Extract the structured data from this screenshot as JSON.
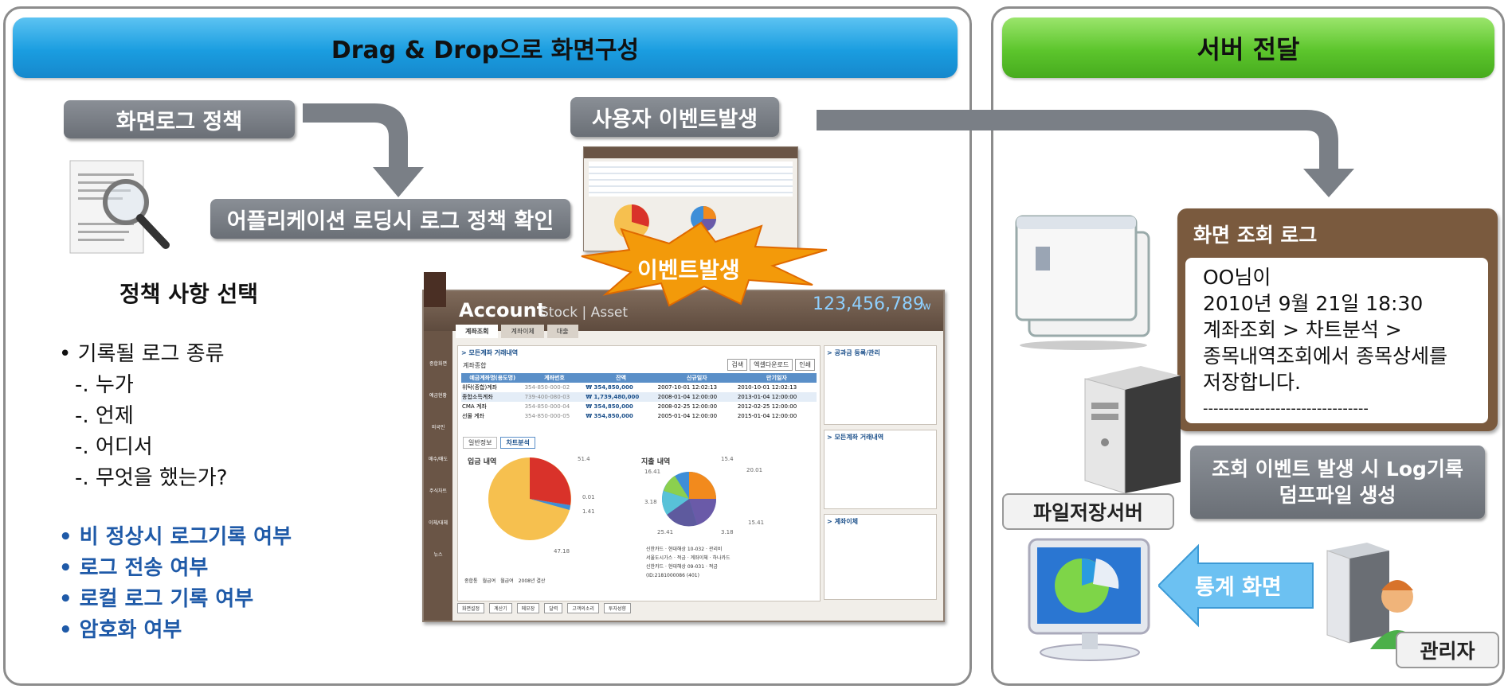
{
  "left_panel": {
    "banner": "Drag & Drop으로 화면구성",
    "policy_box": "화면로그 정책",
    "app_loading_box": "어플리케이션 로딩시 로그 정책 확인",
    "user_event_box": "사용자 이벤트발생",
    "policy_select_title": "정책 사항 선택",
    "bullets": [
      "• 기록될 로그 종류",
      "-. 누가",
      "-. 언제",
      "-. 어디서",
      "-. 무엇을 했는가?"
    ],
    "blue_bullets": [
      "• 비 정상시 로그기록 여부",
      "• 로그 전송 여부",
      "• 로컬 로그 기록 여부",
      "• 암호화 여부"
    ],
    "event_burst": "이벤트발생"
  },
  "account_screen": {
    "title": "Account",
    "subtitle": "Stock | Asset",
    "amount": "123,456,789",
    "amount_unit": "w",
    "tabs": [
      "계좌조회",
      "계좌이체",
      "대출"
    ],
    "section_title": "> 모든계좌 거래내역",
    "filter_label": "계좌종합",
    "buttons": [
      "검색",
      "엑셀다운로드",
      "인쇄"
    ],
    "table_headers": [
      "예금계좌명(용도명)",
      "계좌번호",
      "잔액",
      "신규일자",
      "만기일자"
    ],
    "table_rows": [
      [
        "위탁(종합)계좌",
        "354-850-000-02",
        "₩ 354,850,000",
        "2007-10-01 12:02:13",
        "2010-10-01 12:02:13"
      ],
      [
        "종합소득계좌",
        "739-400-080-03",
        "₩ 1,739,480,000",
        "2008-01-04 12:00:00",
        "2013-01-04 12:00:00"
      ],
      [
        "CMA 계좌",
        "354-850-000-04",
        "₩ 354,850,000",
        "2008-02-25 12:00:00",
        "2012-02-25 12:00:00"
      ],
      [
        "선물 계좌",
        "354-850-000-05",
        "₩ 354,850,000",
        "2005-01-04 12:00:00",
        "2015-01-04 12:00:00"
      ]
    ],
    "sub_tabs": [
      "일반정보",
      "차트분석"
    ],
    "income_title": "입금 내역",
    "expense_title": "지출 내역",
    "income_labels": [
      "51.4",
      "0.01",
      "1.41",
      "47.18"
    ],
    "expense_labels": [
      "15.4",
      "16.41",
      "20.01",
      "3.18",
      "25.41",
      "3.18",
      "15.41"
    ],
    "income_legend": [
      "종합통",
      "월급여",
      "월급여",
      "2008년 결산"
    ],
    "expense_legend": [
      "신한카드",
      "현대해상 10-032",
      "관리비",
      "서울도시가스",
      "적금",
      "계좌이체",
      "하나카드",
      "신한카드",
      "현대해상 09-031",
      "적금",
      "(ID:2181000086 (401)"
    ],
    "right_sections": [
      "> 공과금 등록/관리",
      "> 모든계좌 거래내역",
      "> 계좌이체"
    ],
    "side_icons": [
      "종합화면",
      "예금현황",
      "외국인",
      "매수/매도",
      "주식차트",
      "이체/대체",
      "뉴스"
    ],
    "bottom_buttons": [
      "화면설정",
      "계산기",
      "메모장",
      "달력",
      "고객의소리",
      "투자성향"
    ]
  },
  "right_panel": {
    "banner": "서버 전달",
    "log_title": "화면 조회 로그",
    "log_lines": [
      "OO님이",
      "2010년 9월 21일 18:30",
      "계좌조회 > 차트분석 >",
      "종목내역조회에서 종목상세를",
      "저장합니다.",
      "--------------------------------"
    ],
    "dump_box": "조회 이벤트 발생 시 Log기록\n덤프파일 생성",
    "file_server_label": "파일저장서버",
    "stats_label": "통계 화면",
    "admin_label": "관리자"
  },
  "colors": {
    "blue_banner": "#1a9de0",
    "green_banner": "#5cc52c",
    "gray_box": "#6f747b",
    "log_brown": "#7a5a3e",
    "blue_text": "#1f5aa8",
    "burst_orange": "#f39a0a"
  }
}
